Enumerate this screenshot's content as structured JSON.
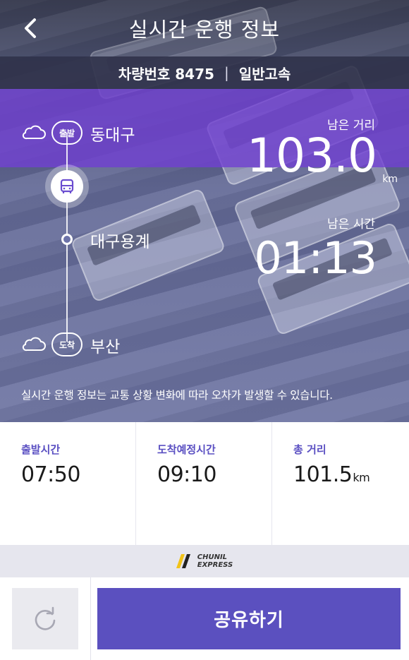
{
  "header": {
    "title": "실시간 운행 정보",
    "back_icon": "chevron-left-icon"
  },
  "vehicle": {
    "number_label": "차량번호 8475",
    "separator": "|",
    "grade": "일반고속"
  },
  "route": {
    "origin": {
      "badge": "출발",
      "name": "동대구"
    },
    "via": {
      "name": "대구용계"
    },
    "destination": {
      "badge": "도착",
      "name": "부산"
    },
    "weather_icon": "cloud-icon",
    "bus_icon": "bus-icon"
  },
  "metrics": {
    "remaining_distance_label": "남은 거리",
    "remaining_distance_value": "103.0",
    "remaining_distance_unit": "km",
    "remaining_time_label": "남은 시간",
    "remaining_time_value": "01:13"
  },
  "notice": "실시간 운행 정보는 교통 상황 변화에 따라 오차가 발생할 수 있습니다.",
  "info": {
    "departure_label": "출발시간",
    "departure_value": "07:50",
    "arrival_label": "도착예정시간",
    "arrival_value": "09:10",
    "total_distance_label": "총 거리",
    "total_distance_value": "101.5",
    "total_distance_unit": "km"
  },
  "brand": {
    "line1": "CHUNIL",
    "line2": "EXPRESS",
    "accent_color": "#f2c318"
  },
  "actions": {
    "refresh_icon": "refresh-icon",
    "share_label": "공유하기"
  },
  "colors": {
    "purple": "#7040d2",
    "button": "#5b50bf",
    "label": "#5a4fc2"
  }
}
